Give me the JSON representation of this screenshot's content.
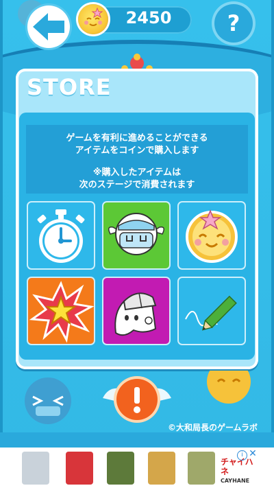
{
  "header": {
    "coin_count": "2450",
    "help_label": "?"
  },
  "store": {
    "title": "STORE",
    "description": [
      "ゲームを有利に進めることができる",
      "アイテムをコインで購入します",
      "※購入したアイテムは",
      "次のステージで消費されます"
    ],
    "items": [
      {
        "icon": "stopwatch-icon",
        "bg": "#2eb8ea"
      },
      {
        "icon": "mask-ghost-icon",
        "bg": "#5cc836"
      },
      {
        "icon": "smiling-coin-icon",
        "bg": "#2eb8ea"
      },
      {
        "icon": "explosion-star-icon",
        "bg": "#f47a1a"
      },
      {
        "icon": "helmet-ghost-icon",
        "bg": "#c21bb2"
      },
      {
        "icon": "pencil-icon",
        "bg": "#2eb8ea"
      }
    ]
  },
  "footer": {
    "copyright": "©大和局長のゲームラボ"
  },
  "ad": {
    "brand_line1": "チャイハネ",
    "brand_line2": "CAYHANE",
    "info_label": "i",
    "close_label": "✕"
  },
  "colors": {
    "accent": "#2ab3e5",
    "panel": "#a9e6fa",
    "coin": "#f8c83a"
  }
}
